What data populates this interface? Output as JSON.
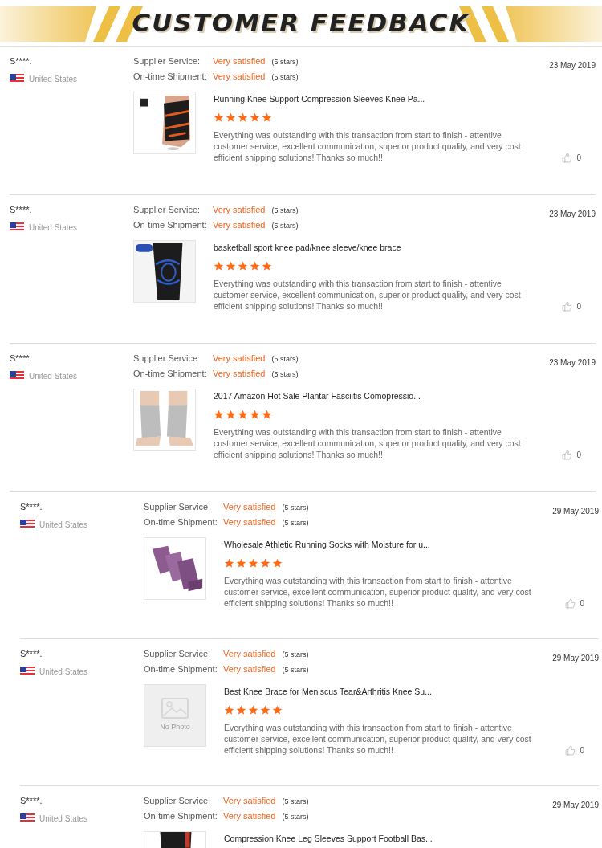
{
  "header": {
    "title": "CUSTOMER FEEDBACK"
  },
  "sections": [
    {
      "reviews": [
        {
          "name": "S****.",
          "country": "United States",
          "date": "23 May 2019",
          "ratings": [
            {
              "label": "Supplier Service:",
              "value": "Very satisfied",
              "note": "(5 stars)"
            },
            {
              "label": "On-time Shipment:",
              "value": "Very satisfied",
              "note": "(5 stars)"
            }
          ],
          "image": {
            "kind": "picture"
          },
          "product": "Running Knee Support Compression Sleeves Knee Pa...",
          "stars": 5,
          "comment": "Everything was outstanding with this transaction from start to finish - attentive customer service, excellent communication, superior product quality, and very cost efficient shipping solutions! Thanks so much!!",
          "likes": "0"
        },
        {
          "name": "S****.",
          "country": "United States",
          "date": "23 May 2019",
          "ratings": [
            {
              "label": "Supplier Service:",
              "value": "Very satisfied",
              "note": "(5 stars)"
            },
            {
              "label": "On-time Shipment:",
              "value": "Very satisfied",
              "note": "(5 stars)"
            }
          ],
          "image": {
            "kind": "picture"
          },
          "product": "basketball sport knee pad/knee sleeve/knee brace",
          "stars": 5,
          "comment": "Everything was outstanding with this transaction from start to finish - attentive customer service, excellent communication, superior product quality, and very cost efficient shipping solutions! Thanks so much!!",
          "likes": "0"
        },
        {
          "name": "S****.",
          "country": "United States",
          "date": "23 May 2019",
          "ratings": [
            {
              "label": "Supplier Service:",
              "value": "Very satisfied",
              "note": "(5 stars)"
            },
            {
              "label": "On-time Shipment:",
              "value": "Very satisfied",
              "note": "(5 stars)"
            }
          ],
          "image": {
            "kind": "picture"
          },
          "product": "2017 Amazon Hot Sale Plantar Fasciitis Comopressio...",
          "stars": 5,
          "comment": "Everything was outstanding with this transaction from start to finish - attentive customer service, excellent communication, superior product quality, and very cost efficient shipping solutions! Thanks so much!!",
          "likes": "0"
        }
      ]
    },
    {
      "reviews": [
        {
          "name": "S****.",
          "country": "United States",
          "date": "29 May 2019",
          "ratings": [
            {
              "label": "Supplier Service:",
              "value": "Very satisfied",
              "note": "(5 stars)"
            },
            {
              "label": "On-time Shipment:",
              "value": "Very satisfied",
              "note": "(5 stars)"
            }
          ],
          "image": {
            "kind": "picture"
          },
          "product": "Wholesale Athletic Running Socks with Moisture for u...",
          "stars": 5,
          "comment": "Everything was outstanding with this transaction from start to finish - attentive customer service, excellent communication, superior product quality, and very cost efficient shipping solutions! Thanks so much!!",
          "likes": "0"
        },
        {
          "name": "S****.",
          "country": "United States",
          "date": "29 May 2019",
          "ratings": [
            {
              "label": "Supplier Service:",
              "value": "Very satisfied",
              "note": "(5 stars)"
            },
            {
              "label": "On-time Shipment:",
              "value": "Very satisfied",
              "note": "(5 stars)"
            }
          ],
          "image": {
            "kind": "no_photo",
            "text": "No Photo"
          },
          "product": "Best Knee Brace for Meniscus Tear&Arthritis Knee Su...",
          "stars": 5,
          "comment": "Everything was outstanding with this transaction from start to finish - attentive customer service, excellent communication, superior product quality, and very cost efficient shipping solutions! Thanks so much!!",
          "likes": "0"
        },
        {
          "name": "S****.",
          "country": "United States",
          "date": "29 May 2019",
          "ratings": [
            {
              "label": "Supplier Service:",
              "value": "Very satisfied",
              "note": "(5 stars)"
            },
            {
              "label": "On-time Shipment:",
              "value": "Very satisfied",
              "note": "(5 stars)"
            }
          ],
          "image": {
            "kind": "picture"
          },
          "product": "Compression Knee Leg Sleeves Support Football Bas..."
        }
      ]
    }
  ]
}
